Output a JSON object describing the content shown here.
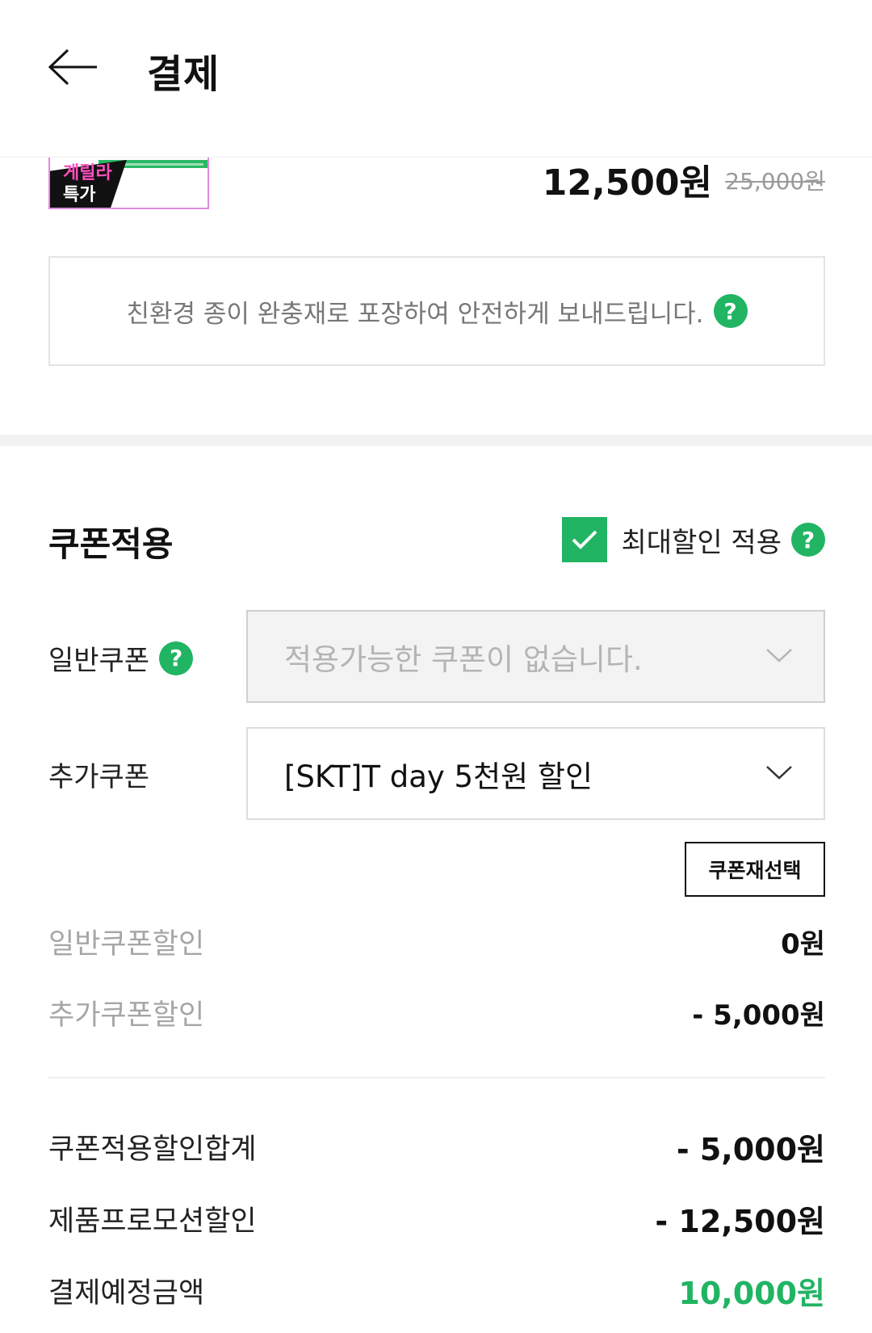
{
  "header": {
    "title": "결제"
  },
  "product": {
    "badge_line1": "게릴라",
    "badge_line2": "특가",
    "sale_price": "12,500원",
    "original_price": "25,000원"
  },
  "eco_notice": {
    "text": "친환경 종이 완충재로 포장하여 안전하게 보내드립니다."
  },
  "coupon": {
    "title": "쿠폰적용",
    "max_discount_label": "최대할인 적용",
    "max_discount_checked": true,
    "general_label": "일반쿠폰",
    "general_placeholder": "적용가능한 쿠폰이 없습니다.",
    "extra_label": "추가쿠폰",
    "extra_selected": "[SKT]T day 5천원 할인",
    "reselect_label": "쿠폰재선택"
  },
  "summary": {
    "general_discount_label": "일반쿠폰할인",
    "general_discount_value": "0원",
    "extra_discount_label": "추가쿠폰할인",
    "extra_discount_value": "- 5,000원",
    "coupon_total_label": "쿠폰적용할인합계",
    "coupon_total_value": "- 5,000원",
    "promo_label": "제품프로모션할인",
    "promo_value": "- 12,500원",
    "expected_label": "결제예정금액",
    "expected_value": "10,000원"
  },
  "colors": {
    "accent": "#21b463",
    "badge_pink": "#ff4fbf"
  },
  "icons": {
    "back": "arrow-left-icon",
    "help": "question-circle-icon",
    "check": "check-icon",
    "chevron": "chevron-down-icon"
  }
}
